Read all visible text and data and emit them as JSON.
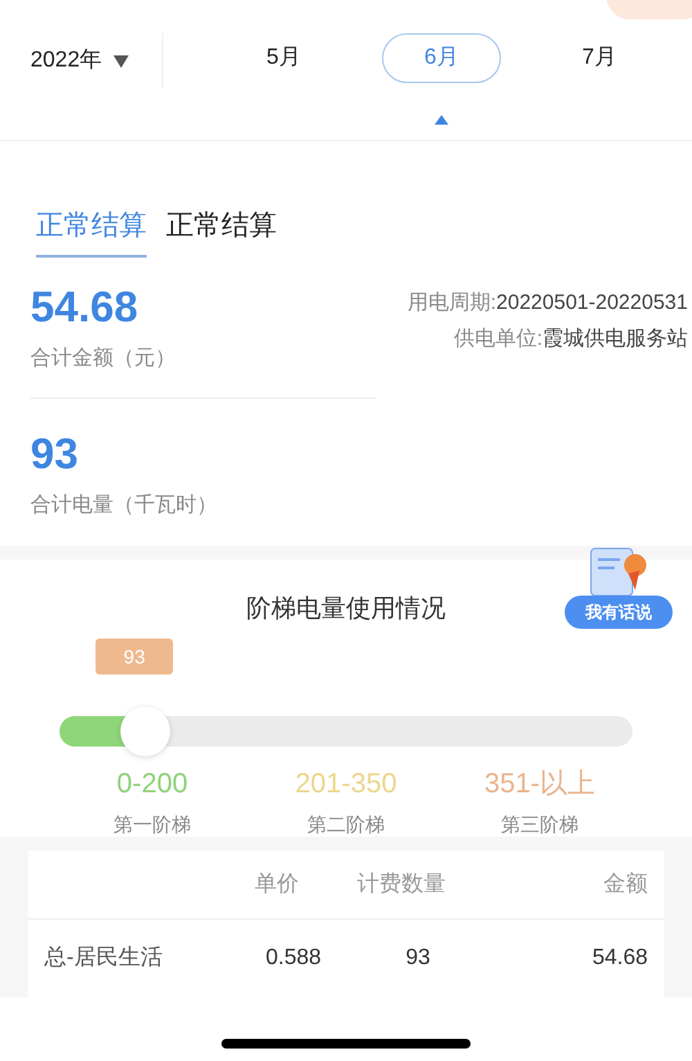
{
  "year_picker": {
    "label": "2022年"
  },
  "months": [
    {
      "label": "5月",
      "selected": false
    },
    {
      "label": "6月",
      "selected": true
    },
    {
      "label": "7月",
      "selected": false
    }
  ],
  "tabs": [
    {
      "label": "正常结算",
      "selected": true
    },
    {
      "label": "正常结算",
      "selected": false
    }
  ],
  "total_amount": {
    "value": "54.68",
    "label": "合计金额（元）"
  },
  "period": {
    "label": "用电周期:",
    "value": "20220501-20220531"
  },
  "supplier": {
    "label": "供电单位:",
    "value": "霞城供电服务站"
  },
  "total_usage": {
    "value": "93",
    "label": "合计电量（千瓦时）"
  },
  "tier_section": {
    "title": "阶梯电量使用情况",
    "feedback_button": "我有话说",
    "bubble": "93",
    "level": 0.15
  },
  "tiers": [
    {
      "range": "0-200",
      "name": "第一阶梯",
      "color": "#8fd27a"
    },
    {
      "range": "201-350",
      "name": "第二阶梯",
      "color": "#ecd68a"
    },
    {
      "range": "351-以上",
      "name": "第三阶梯",
      "color": "#eab48c"
    }
  ],
  "table": {
    "columns": [
      "",
      "单价",
      "计费数量",
      "金额"
    ],
    "rows": [
      [
        "总-居民生活",
        "0.588",
        "93",
        "54.68"
      ]
    ]
  }
}
